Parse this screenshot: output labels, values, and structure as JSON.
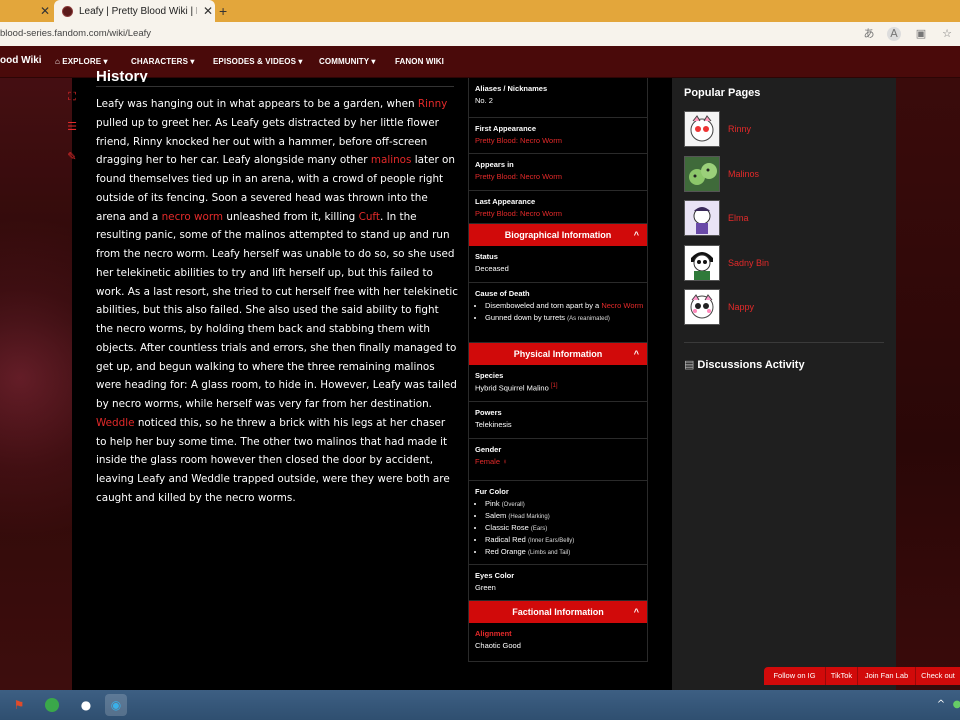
{
  "browser": {
    "tab_active_title": "Leafy | Pretty Blood Wiki | Fandom",
    "url": "blood-series.fandom.com/wiki/Leafy"
  },
  "nav": {
    "logo": "ood Wiki",
    "items": [
      "EXPLORE",
      "CHARACTERS",
      "EPISODES & VIDEOS",
      "COMMUNITY",
      "FANON WIKI"
    ]
  },
  "article": {
    "heading": "History",
    "paragraph": [
      {
        "t": "Leafy was hanging out in what appears to be a garden, when "
      },
      {
        "t": "Rinny",
        "link": true
      },
      {
        "t": " pulled up to greet her. As Leafy gets distracted by her little flower friend, Rinny knocked her out with a hammer, before off-screen dragging her to her car. Leafy alongside many other "
      },
      {
        "t": "malinos",
        "link": true
      },
      {
        "t": " later on found themselves tied up in an arena, with a crowd of people right outside of its fencing. Soon a severed head was thrown into the arena and a "
      },
      {
        "t": "necro worm",
        "link": true
      },
      {
        "t": " unleashed from it, killing "
      },
      {
        "t": "Cuft",
        "link": true
      },
      {
        "t": ". In the resulting panic, some of the malinos attempted to stand up and run from the necro worm. Leafy herself was unable to do so, so she used her telekinetic abilities to try and lift herself up, but this failed to work. As a last resort, she tried to cut herself free with her telekinetic abilities, but this also failed. She also used the said ability to fight the necro worms, by holding them back and stabbing them with objects. After countless trials and errors, she then finally managed to get up, and begun walking to where the three remaining malinos were heading for: A glass room, to hide in. However, Leafy was tailed by necro worms, while herself was very far from her destination. "
      },
      {
        "t": "Weddle",
        "link": true
      },
      {
        "t": " noticed this, so he threw a brick with his legs at her chaser to help her buy some time. The other two malinos that had made it inside the glass room however then closed the door by accident, leaving Leafy and Weddle trapped outside, were they were both are caught and killed by the necro worms."
      }
    ]
  },
  "infobox": {
    "aliases_label": "Aliases / Nicknames",
    "aliases_value": "No. 2",
    "first_label": "First Appearance",
    "first_value": "Pretty Blood: Necro Worm",
    "appears_label": "Appears in",
    "appears_value": "Pretty Blood: Necro Worm",
    "last_label": "Last Appearance",
    "last_value": "Pretty Blood: Necro Worm",
    "bio_header": "Biographical Information",
    "status_label": "Status",
    "status_value": "Deceased",
    "cause_label": "Cause of Death",
    "cause_1": "Disemboweled and torn apart by a ",
    "cause_1_link": "Necro Worm",
    "cause_2": "Gunned down by turrets ",
    "cause_2_small": "(As reanimated)",
    "phys_header": "Physical Information",
    "species_label": "Species",
    "species_value": "Hybrid Squirrel Malino",
    "species_ref": "[1]",
    "powers_label": "Powers",
    "powers_value": "Telekinesis",
    "gender_label": "Gender",
    "gender_value": "Female ♀",
    "fur_label": "Fur Color",
    "fur": [
      {
        "c": "Pink ",
        "n": "(Overall)"
      },
      {
        "c": "Salem ",
        "n": "(Head Marking)"
      },
      {
        "c": "Classic Rose ",
        "n": "(Ears)"
      },
      {
        "c": "Radical Red ",
        "n": "(Inner Ears/Belly)"
      },
      {
        "c": "Red Orange ",
        "n": "(Limbs and Tail)"
      }
    ],
    "eyes_label": "Eyes Color",
    "eyes_value": "Green",
    "fact_header": "Factional Information",
    "align_label": "Alignment",
    "align_value": "Chaotic Good"
  },
  "rail": {
    "popular_title": "Popular Pages",
    "popular": [
      "Rinny",
      "Malinos",
      "Elma",
      "Sadny Bin",
      "Nappy"
    ],
    "discussions": "Discussions Activity"
  },
  "follow": [
    "Follow on IG",
    "TikTok",
    "Join Fan Lab",
    "Check out"
  ],
  "colors": {
    "accent": "#e32a2a",
    "nav_bg": "#4a0a0a",
    "section_header": "#d10a0a"
  }
}
